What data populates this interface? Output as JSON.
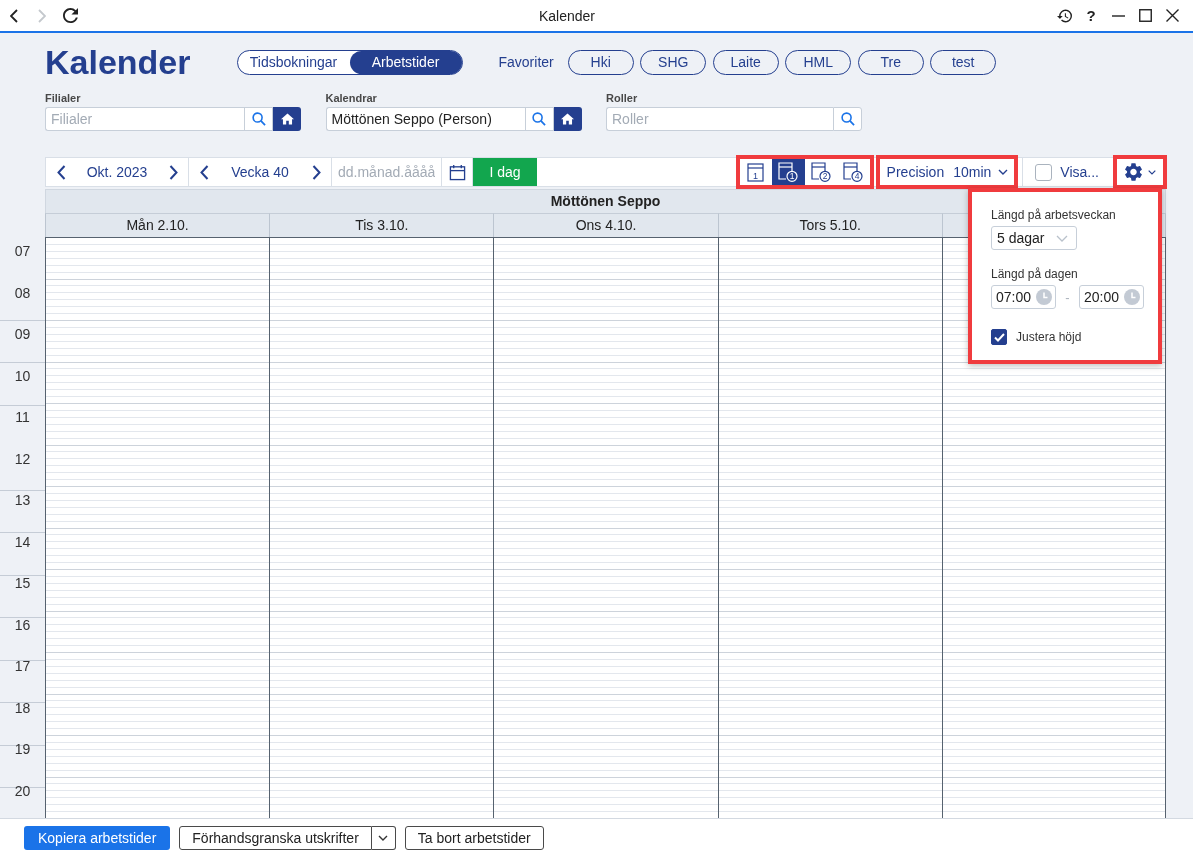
{
  "titlebar": {
    "title": "Kalender",
    "nav": [
      {
        "kind": "back",
        "disabled": false
      },
      {
        "kind": "forward",
        "disabled": true
      },
      {
        "kind": "reload",
        "disabled": false
      }
    ],
    "controls": [
      {
        "kind": "history"
      },
      {
        "kind": "help",
        "label": "?"
      },
      {
        "kind": "minimize"
      },
      {
        "kind": "maximize"
      },
      {
        "kind": "close"
      }
    ]
  },
  "header": {
    "title": "Kalender",
    "modes": [
      {
        "label": "Tidsbokningar",
        "selected": false
      },
      {
        "label": "Arbetstider",
        "selected": true
      }
    ],
    "favorites_label": "Favoriter",
    "favorites": [
      "Hki",
      "SHG",
      "Laite",
      "HML",
      "Tre",
      "test"
    ]
  },
  "filters": [
    {
      "label": "Filialer",
      "placeholder": "Filialer",
      "home_button": true
    },
    {
      "label": "Kalendrar",
      "value": "Möttönen Seppo (Person)",
      "home_button": true
    },
    {
      "label": "Roller",
      "placeholder": "Roller",
      "home_button": false
    }
  ],
  "toolbar": {
    "month": "Okt. 2023",
    "week": "Vecka 40",
    "date_placeholder": "dd.månad.åååå",
    "today": "I dag",
    "views": {
      "highlighted": true,
      "items": [
        {
          "kind": "plain",
          "label": "1",
          "selected": false
        },
        {
          "kind": "circled",
          "label": "1",
          "selected": true
        },
        {
          "kind": "circled",
          "label": "2",
          "selected": false
        },
        {
          "kind": "circled",
          "label": "4",
          "selected": false
        }
      ]
    },
    "precision": {
      "label": "Precision",
      "value": "10min",
      "highlighted": true
    },
    "show": {
      "label": "Visa...",
      "checked": false
    },
    "settings": {
      "highlighted": true,
      "expanded": true
    }
  },
  "calendar": {
    "person": "Möttönen Seppo",
    "days": [
      {
        "kind": "day",
        "label": "Mån 2.10."
      },
      {
        "kind": "day",
        "label": "Tis 3.10."
      },
      {
        "kind": "day",
        "label": "Ons 4.10."
      },
      {
        "kind": "day",
        "label": "Tors 5.10."
      },
      {
        "kind": "covered"
      }
    ],
    "hours": [
      "07",
      "08",
      "09",
      "10",
      "11",
      "12",
      "13",
      "14",
      "15",
      "16",
      "17",
      "18",
      "19",
      "20"
    ]
  },
  "settings_panel": {
    "highlighted": true,
    "week_length_label": "Längd på arbetsveckan",
    "week_length": "5 dagar",
    "day_length_label": "Längd på dagen",
    "day_start": "07:00",
    "separator": "-",
    "day_end": "20:00",
    "adjust_height": {
      "label": "Justera höjd",
      "checked": true
    }
  },
  "bottom_bar": {
    "buttons": [
      {
        "kind": "primary",
        "label": "Kopiera arbetstider"
      },
      {
        "kind": "split",
        "label": "Förhandsgranska utskrifter"
      },
      {
        "kind": "secondary",
        "label": "Ta bort arbetstider"
      }
    ]
  }
}
